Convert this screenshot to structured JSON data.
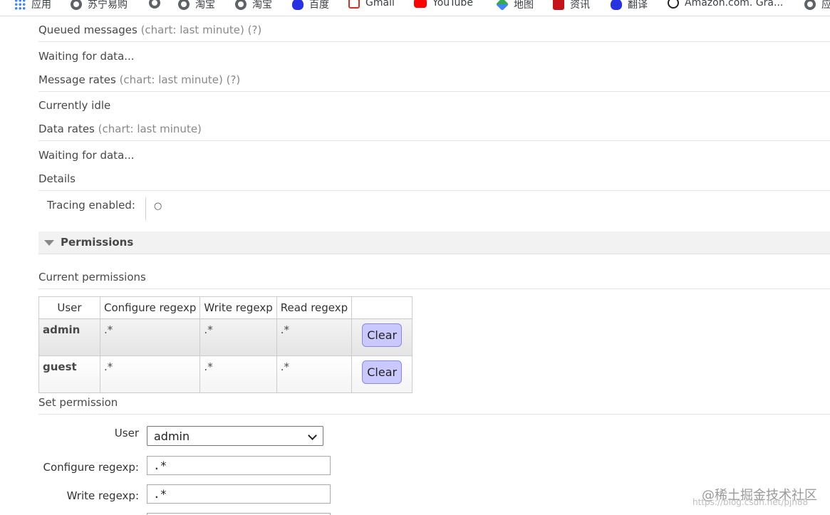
{
  "bookmarks": [
    {
      "label": "应用",
      "icon": "apps-grid-icon"
    },
    {
      "label": "苏宁易购",
      "icon": "globe-icon"
    },
    {
      "label": "",
      "icon": "globe-icon"
    },
    {
      "label": "淘宝",
      "icon": "globe-icon"
    },
    {
      "label": "淘宝",
      "icon": "globe-icon"
    },
    {
      "label": "百度",
      "icon": "baidu-icon"
    },
    {
      "label": "Gmail",
      "icon": "gmail-icon"
    },
    {
      "label": "YouTube",
      "icon": "youtube-icon"
    },
    {
      "label": "地图",
      "icon": "maps-icon"
    },
    {
      "label": "资讯",
      "icon": "news-icon"
    },
    {
      "label": "翻译",
      "icon": "baidu-icon"
    },
    {
      "label": "Amazon.com. Gra...",
      "icon": "amazon-icon"
    },
    {
      "label": "应",
      "icon": "globe-icon"
    }
  ],
  "queued": {
    "title": "Queued messages",
    "sub": "(chart: last minute) (?)",
    "status": "Waiting for data..."
  },
  "rates": {
    "title": "Message rates",
    "sub": "(chart: last minute) (?)",
    "status": "Currently idle"
  },
  "data_rates": {
    "title": "Data rates",
    "sub": "(chart: last minute)",
    "status": "Waiting for data..."
  },
  "details": {
    "title": "Details",
    "tracing_label": "Tracing enabled:",
    "tracing_value": "○"
  },
  "permissions": {
    "title": "Permissions",
    "current_title": "Current permissions",
    "columns": [
      "User",
      "Configure regexp",
      "Write regexp",
      "Read regexp",
      ""
    ],
    "rows": [
      {
        "user": "admin",
        "configure": ".*",
        "write": ".*",
        "read": ".*",
        "action": "Clear"
      },
      {
        "user": "guest",
        "configure": ".*",
        "write": ".*",
        "read": ".*",
        "action": "Clear"
      }
    ]
  },
  "set_permission": {
    "title": "Set permission",
    "user_label": "User",
    "user_value": "admin",
    "configure_label": "Configure regexp:",
    "configure_value": ".*",
    "write_label": "Write regexp:",
    "write_value": ".*"
  },
  "watermark": {
    "main": "@稀土掘金技术社区",
    "sub": "https://blog.csdn.net/pjh88"
  }
}
